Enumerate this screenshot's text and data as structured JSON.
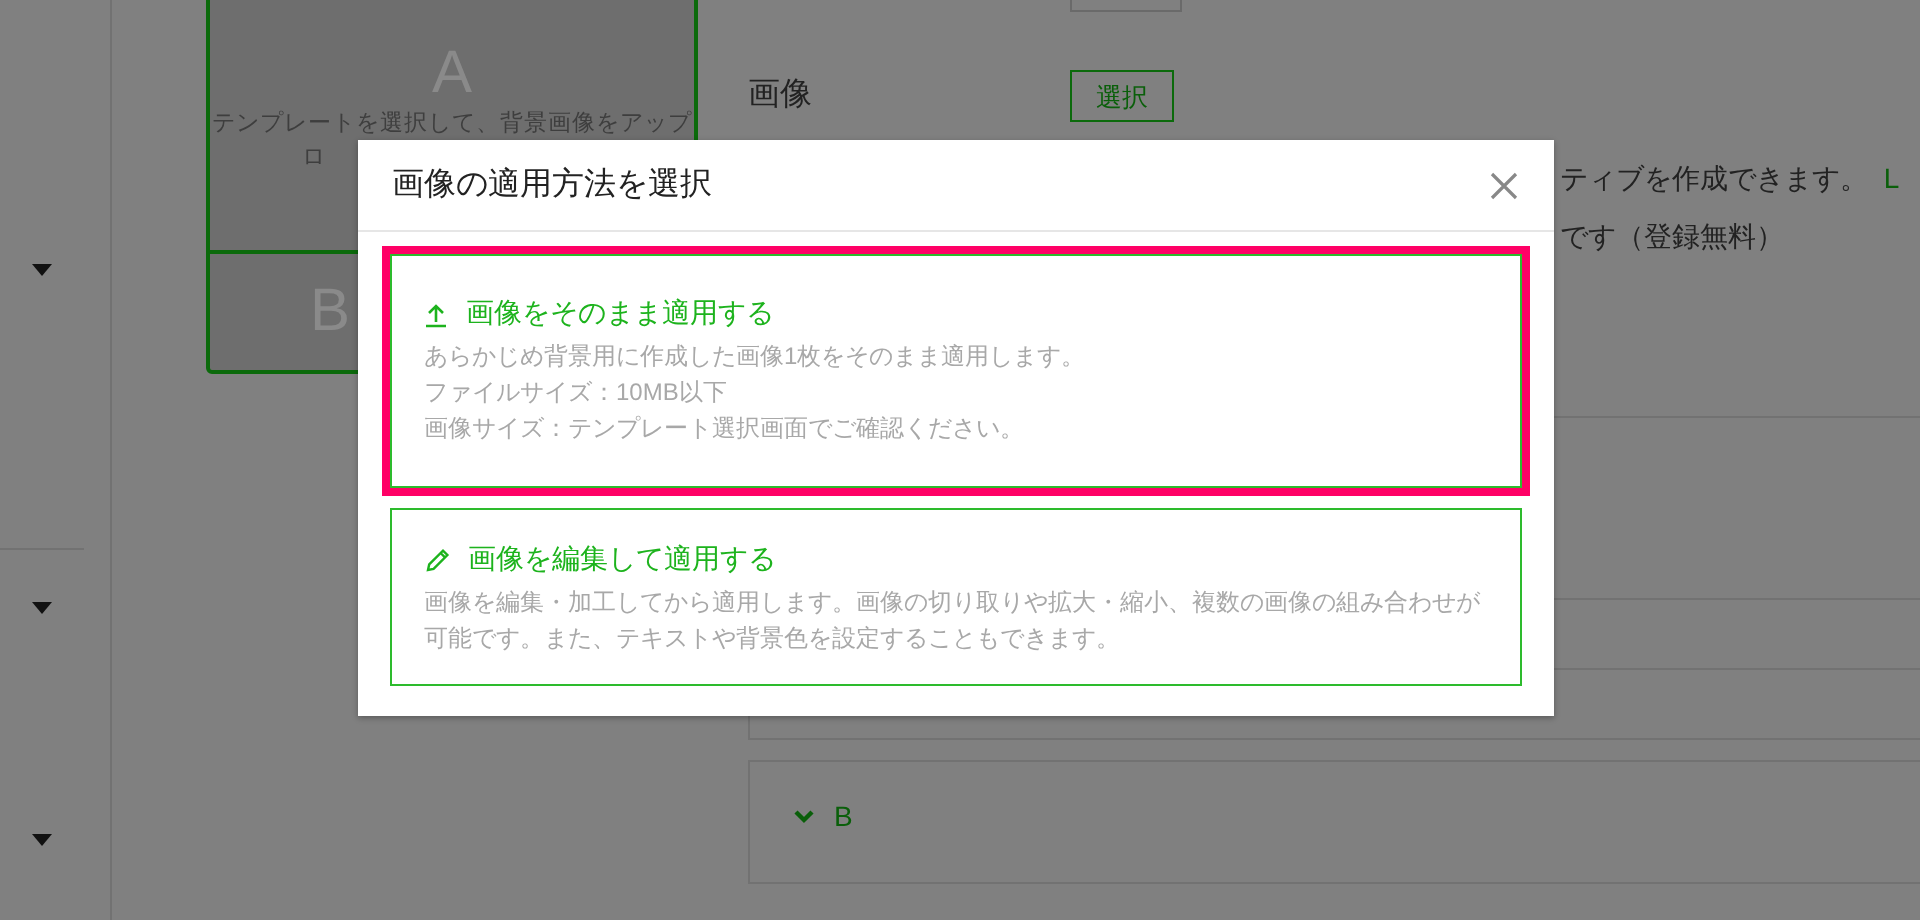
{
  "page": {
    "template_preview": {
      "top_letter": "A",
      "caption_lines": [
        "テンプレートを選択して、背景画像をアップ",
        "ロ"
      ],
      "bottom_letter": "B"
    },
    "image_label": "画像",
    "select_button": "選択",
    "notes": [
      "ティブを作成できます。",
      "です（登録無料）"
    ],
    "link": "L",
    "section": {
      "label": "B"
    }
  },
  "dialog": {
    "title": "画像の適用方法を選択",
    "options": [
      {
        "kind": "upload",
        "title": "画像をそのまま適用する",
        "lines": [
          "あらかじめ背景用に作成した画像1枚をそのまま適用します。",
          "ファイルサイズ：10MB以下",
          "画像サイズ：テンプレート選択画面でご確認ください。"
        ],
        "selected": true
      },
      {
        "kind": "edit",
        "title": "画像を編集して適用する",
        "lines": [
          "画像を編集・加工してから適用します。画像の切り取りや拡大・縮小、複数の画像の組み合わせが可能です。また、テキストや背景色を設定することもできます。"
        ],
        "selected": false
      }
    ]
  }
}
